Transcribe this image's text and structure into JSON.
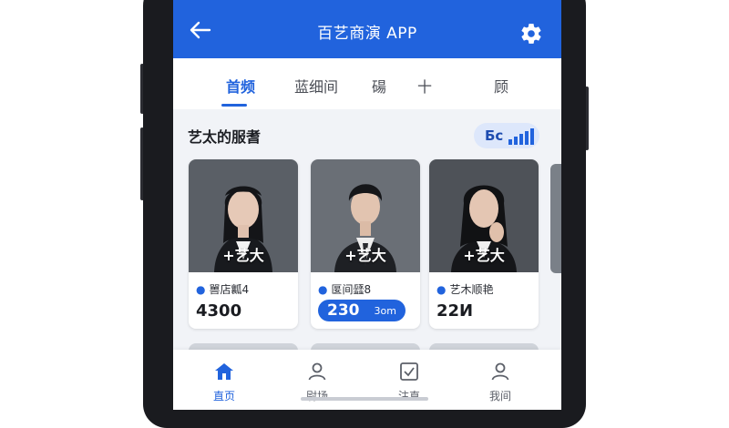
{
  "app": {
    "title": "百艺商演 APP"
  },
  "colors": {
    "primary": "#2163dd",
    "background": "#f1f3f7"
  },
  "icons": {
    "back": "arrow-left-icon",
    "settings": "gear-icon"
  },
  "tabs": [
    {
      "label": "首频",
      "active": true
    },
    {
      "label": "蓝细间",
      "active": false
    },
    {
      "label": "碭",
      "active": false
    },
    {
      "label": "十",
      "active": false
    },
    {
      "label": "顾",
      "active": false
    }
  ],
  "section": {
    "title": "艺太的服耆",
    "badge": "Бс"
  },
  "cards": [
    {
      "overlay": "+艺大",
      "role": "嘼店瓤4",
      "price": "4300"
    },
    {
      "overlay": "+艺大",
      "role": "匽间瓥8",
      "price": "230",
      "unit": "3om"
    },
    {
      "overlay": "+艺大",
      "role": "艺木顺艳",
      "price": "22И"
    }
  ],
  "bottom_nav": [
    {
      "label": "直页",
      "icon": "home-icon",
      "active": true
    },
    {
      "label": "尉场",
      "icon": "user-icon",
      "active": false
    },
    {
      "label": "注直",
      "icon": "checkbox-icon",
      "active": false
    },
    {
      "label": "我间",
      "icon": "profile-icon",
      "active": false
    }
  ]
}
